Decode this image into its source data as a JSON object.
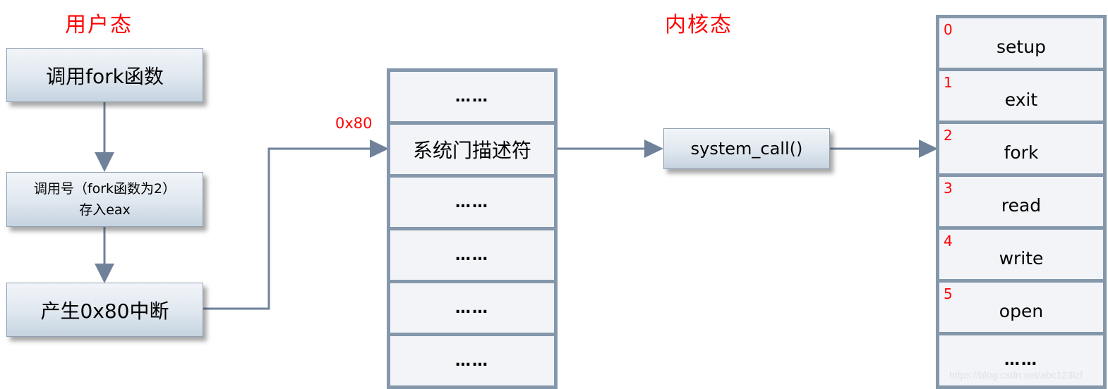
{
  "titles": {
    "user_mode": "用户态",
    "kernel_mode": "内核态"
  },
  "user_flow": {
    "step1": "调用fork函数",
    "step2_line1": "调用号（fork函数为2）",
    "step2_line2": "存入eax",
    "step3": "产生0x80中断"
  },
  "interrupt_vector_label": "0x80",
  "idt_table": {
    "rows": [
      "……",
      "系统门描述符",
      "……",
      "……",
      "……",
      "……"
    ]
  },
  "system_call_handler": "system_call()",
  "syscall_table": {
    "rows": [
      {
        "index": "0",
        "name": "setup"
      },
      {
        "index": "1",
        "name": "exit"
      },
      {
        "index": "2",
        "name": "fork"
      },
      {
        "index": "3",
        "name": "read"
      },
      {
        "index": "4",
        "name": "write"
      },
      {
        "index": "5",
        "name": "open"
      },
      {
        "index": "",
        "name": "……"
      }
    ]
  },
  "watermark": "https://blog.csdn.net/abc123lzf",
  "colors": {
    "title_red": "#ff0000",
    "connector": "#70829a",
    "table_border": "#8497ab",
    "cell_fill": "#f2f4f8"
  }
}
